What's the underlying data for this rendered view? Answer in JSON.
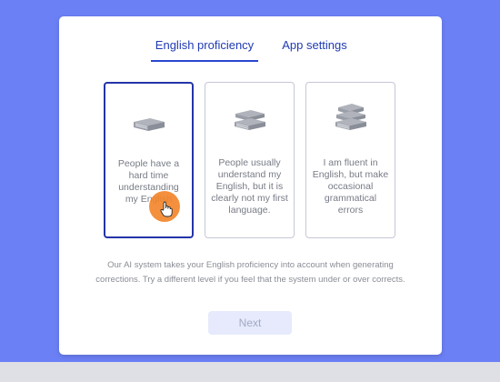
{
  "tabs": {
    "english": "English proficiency",
    "app": "App settings"
  },
  "cards": [
    {
      "text": "People have a hard time understanding my English",
      "icon": "single-book-icon",
      "selected": true
    },
    {
      "text": "People usually understand my English, but it is clearly not my first language.",
      "icon": "two-books-icon",
      "selected": false
    },
    {
      "text": "I am fluent in English, but make occasional grammatical errors",
      "icon": "book-stack-icon",
      "selected": false
    }
  ],
  "info_text": "Our AI system takes your English proficiency into account when generating corrections. Try a different level if you feel that the system under or over corrects.",
  "next_label": "Next",
  "colors": {
    "background": "#6b80f5",
    "accent": "#2947d1",
    "selected_border": "#2434a8",
    "cursor": "#f38428"
  }
}
